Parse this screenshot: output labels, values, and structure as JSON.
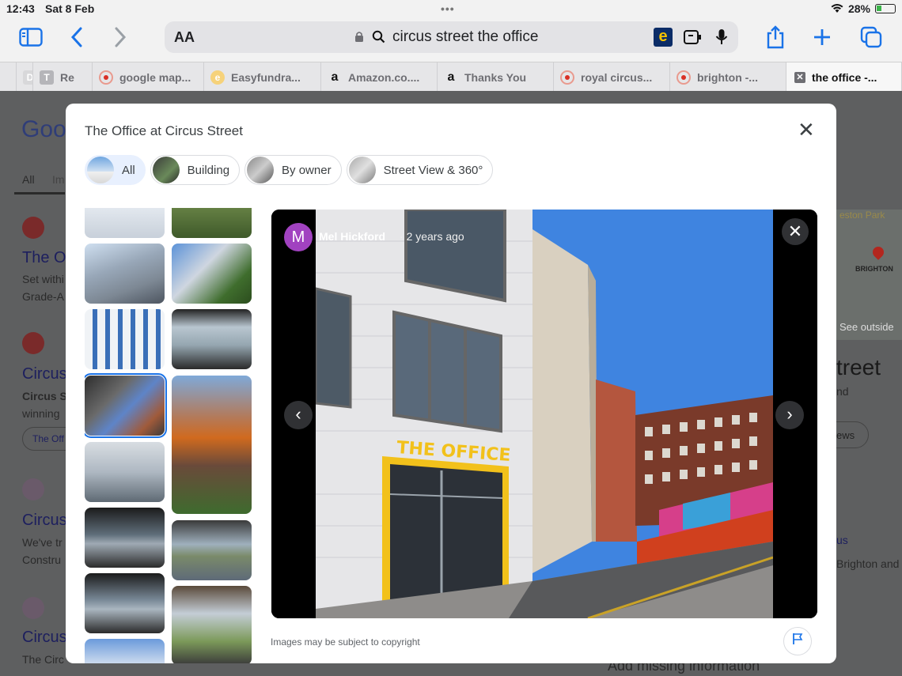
{
  "status": {
    "time": "12:43",
    "date": "Sat 8 Feb",
    "battery": "28%"
  },
  "toolbar": {
    "text_size": "AA",
    "query": "circus street the office"
  },
  "tabs": [
    {
      "label": "D",
      "icon": "doc-favicon"
    },
    {
      "label": "Re",
      "icon": "tab-favicon"
    },
    {
      "label": "google map...",
      "icon": "google-maps-favicon"
    },
    {
      "label": "Easyfundra...",
      "icon": "easyfundraising-favicon"
    },
    {
      "label": "Amazon.co....",
      "icon": "amazon-favicon"
    },
    {
      "label": "Thanks You",
      "icon": "amazon-favicon"
    },
    {
      "label": "royal circus...",
      "icon": "google-maps-favicon"
    },
    {
      "label": "brighton -...",
      "icon": "google-maps-favicon"
    },
    {
      "label": "the office -...",
      "icon": "close-tab-icon",
      "active": true
    }
  ],
  "background": {
    "logo": "Goo",
    "tab_all": "All",
    "tab_im": "Im",
    "r1_title": "The O",
    "r1_snip1": "Set withi",
    "r1_snip2": "Grade-A",
    "r2_title": "Circus",
    "r2_snip1": "Circus S",
    "r2_snip2": "winning",
    "r2_chip": "The Off",
    "r3_title": "Circus",
    "r3_snip1": "We've tr",
    "r3_snip2": "Constru",
    "r4_title": "Circus",
    "r4_snip1": "The Circ",
    "right_map": "eston Park",
    "right_brighton": "BRIGHTON",
    "right_see": "See outside",
    "right_title": "treet",
    "right_sub": "nd",
    "right_views": "ews",
    "right_us": "us",
    "right_brighton_and": "Brighton and",
    "add_missing": "Add missing information"
  },
  "dialog": {
    "title": "The Office at Circus Street",
    "chips": [
      "All",
      "Building",
      "By owner",
      "Street View & 360°"
    ],
    "author_initial": "M",
    "author": "Mel Hickford",
    "time_ago": "2 years ago",
    "sign_text": "THE OFFICE",
    "copyright": "Images may be subject to copyright"
  },
  "colors": {
    "accent": "#1a73e8",
    "avatar": "#a142c0",
    "sign_yellow": "#f2c11b"
  }
}
